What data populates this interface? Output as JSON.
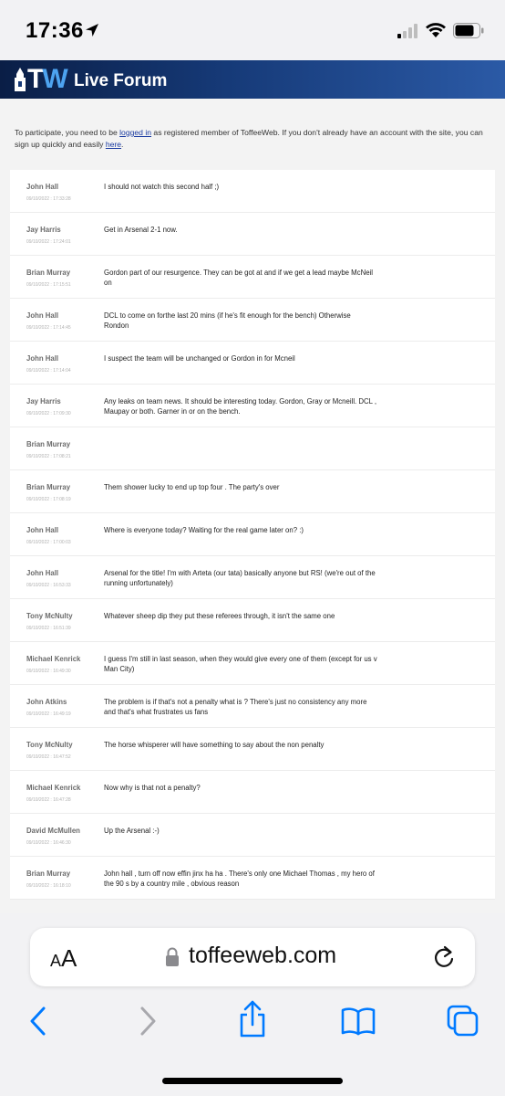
{
  "status": {
    "time": "17:36"
  },
  "header": {
    "logo": "TW",
    "title": "Live Forum"
  },
  "intro": {
    "before_login": "To participate, you need to be ",
    "login_link": "logged in",
    "after_login": " as registered member of ToffeeWeb. If you don't already have an account with the site, you can sign up quickly and easily ",
    "here_link": "here",
    "end": "."
  },
  "posts": [
    {
      "author": "John Hall",
      "date": "09/10/2022 : 17:33:28",
      "text": "I should not watch this second half ;)"
    },
    {
      "author": "Jay Harris",
      "date": "09/10/2022 : 17:24:01",
      "text": "Get in Arsenal 2-1 now."
    },
    {
      "author": "Brian Murray",
      "date": "09/10/2022 : 17:15:51",
      "text": "Gordon part of our resurgence. They can be got at and if we get a lead maybe McNeil on"
    },
    {
      "author": "John Hall",
      "date": "09/10/2022 : 17:14:45",
      "text": "DCL to come on forthe last 20 mins (if he's fit enough for the bench) Otherwise Rondon"
    },
    {
      "author": "John Hall",
      "date": "09/10/2022 : 17:14:04",
      "text": "I suspect the team will be unchanged or Gordon in for Mcneil"
    },
    {
      "author": "Jay Harris",
      "date": "09/10/2022 : 17:09:30",
      "text": "Any leaks on team news. It should be interesting today. Gordon, Gray or Mcneill. DCL , Maupay or both. Garner in or on the bench."
    },
    {
      "author": "Brian Murray",
      "date": "09/10/2022 : 17:08:21",
      "text": ""
    },
    {
      "author": "Brian Murray",
      "date": "09/10/2022 : 17:08:19",
      "text": "Them shower lucky to end up top four . The party's over"
    },
    {
      "author": "John Hall",
      "date": "09/10/2022 : 17:00:03",
      "text": "Where is everyone today? Waiting for the real game later on? :)"
    },
    {
      "author": "John Hall",
      "date": "09/10/2022 : 16:53:33",
      "text": "Arsenal for the title! I'm with Arteta (our tata) basically anyone but RS! (we're out of the running unfortunately)"
    },
    {
      "author": "Tony McNulty",
      "date": "09/10/2022 : 16:51:39",
      "text": "Whatever sheep dip they put these referees through, it isn't the same one"
    },
    {
      "author": "Michael Kenrick",
      "date": "09/10/2022 : 16:49:30",
      "text": "I guess I'm still in last season, when they would give every one of them (except for us v Man City)"
    },
    {
      "author": "John Atkins",
      "date": "09/10/2022 : 16:49:19",
      "text": "The problem is if that's not a penalty what is ? There's just no consistency any more and that's what frustrates us fans"
    },
    {
      "author": "Tony McNulty",
      "date": "09/10/2022 : 16:47:52",
      "text": "The horse whisperer will have something to say about the non penalty"
    },
    {
      "author": "Michael Kenrick",
      "date": "09/10/2022 : 16:47:28",
      "text": "Now why is that not a penalty?"
    },
    {
      "author": "David McMullen",
      "date": "09/10/2022 : 16:46:30",
      "text": "Up the Arsenal :-)"
    },
    {
      "author": "Brian Murray",
      "date": "09/10/2022 : 16:18:10",
      "text": "John hall , turn off now effin jinx ha ha . There's only one Michael Thomas , my hero of the 90 s by a country mile , obvious reason"
    }
  ],
  "browser": {
    "aa_small": "A",
    "aa_large": "A",
    "url": "toffeeweb.com"
  },
  "colors": {
    "header_dark": "#0a1e46",
    "header_light": "#2b5aa6",
    "accent": "#007aff",
    "link": "#1a3aa0"
  },
  "icons": [
    "location-arrow-icon",
    "signal-icon",
    "wifi-icon",
    "battery-icon",
    "lock-icon",
    "reload-icon",
    "back-icon",
    "forward-icon",
    "share-icon",
    "bookmarks-icon",
    "tabs-icon"
  ]
}
